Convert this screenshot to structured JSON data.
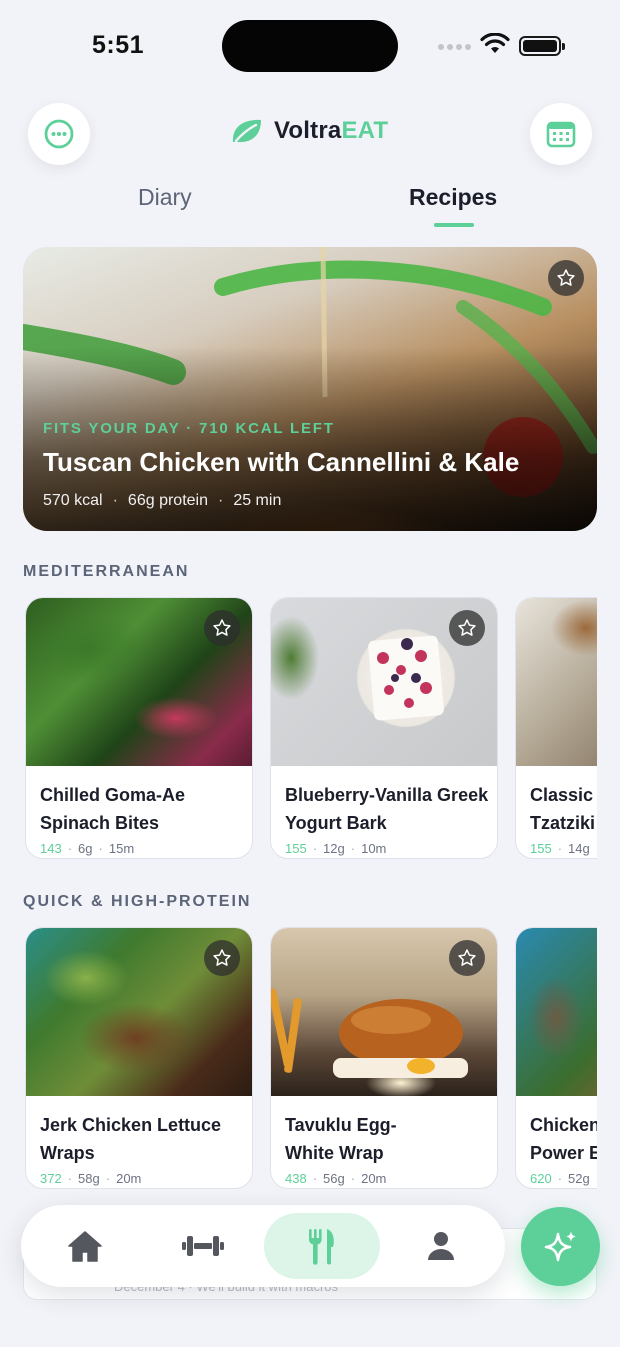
{
  "status_bar": {
    "time": "5:51"
  },
  "header": {
    "logo_prefix": "Voltra",
    "logo_suffix": "EAT",
    "more_icon": "ellipsis-circle-icon",
    "calendar_icon": "calendar-icon"
  },
  "tabs": [
    {
      "label": "Diary",
      "active": false
    },
    {
      "label": "Recipes",
      "active": true
    }
  ],
  "hero": {
    "kicker": "FITS YOUR DAY · 710 KCAL LEFT",
    "title": "Tuscan Chicken with Cannellini & Kale",
    "kcal": "570 kcal",
    "protein": "66g protein",
    "time": "25 min",
    "separator": "·"
  },
  "sections": [
    {
      "title": "MEDITERRANEAN",
      "cards": [
        {
          "title": "Chilled Goma-Ae Spinach Bites",
          "kcal": "143",
          "protein": "6g",
          "time": "15m"
        },
        {
          "title": "Blueberry-Vanilla Greek Yogurt Bark",
          "kcal": "155",
          "protein": "12g",
          "time": "10m"
        },
        {
          "title": "Classic Tzatziki",
          "kcal": "155",
          "protein": "14g",
          "time": ""
        }
      ]
    },
    {
      "title": "QUICK & HIGH-PROTEIN",
      "cards": [
        {
          "title": "Jerk Chicken Lettuce Wraps",
          "kcal": "372",
          "protein": "58g",
          "time": "20m"
        },
        {
          "title": "Tavuklu Egg-White Wrap",
          "kcal": "438",
          "protein": "56g",
          "time": "20m"
        },
        {
          "title": "Chicken Power B",
          "kcal": "620",
          "protein": "52g",
          "time": ""
        }
      ]
    }
  ],
  "peek": {
    "text": "December 4 · We'll build it with macros"
  },
  "bottom_nav": [
    {
      "name": "home",
      "icon": "home-icon"
    },
    {
      "name": "workout",
      "icon": "dumbbell-icon"
    },
    {
      "name": "recipes",
      "icon": "fork-knife-icon",
      "active": true
    },
    {
      "name": "profile",
      "icon": "person-icon"
    }
  ],
  "fab": {
    "icon": "sparkle-icon"
  },
  "colors": {
    "accent": "#5dcf98",
    "background": "#f2f3f8",
    "text": "#1c1f2b",
    "muted": "#5b6478"
  }
}
